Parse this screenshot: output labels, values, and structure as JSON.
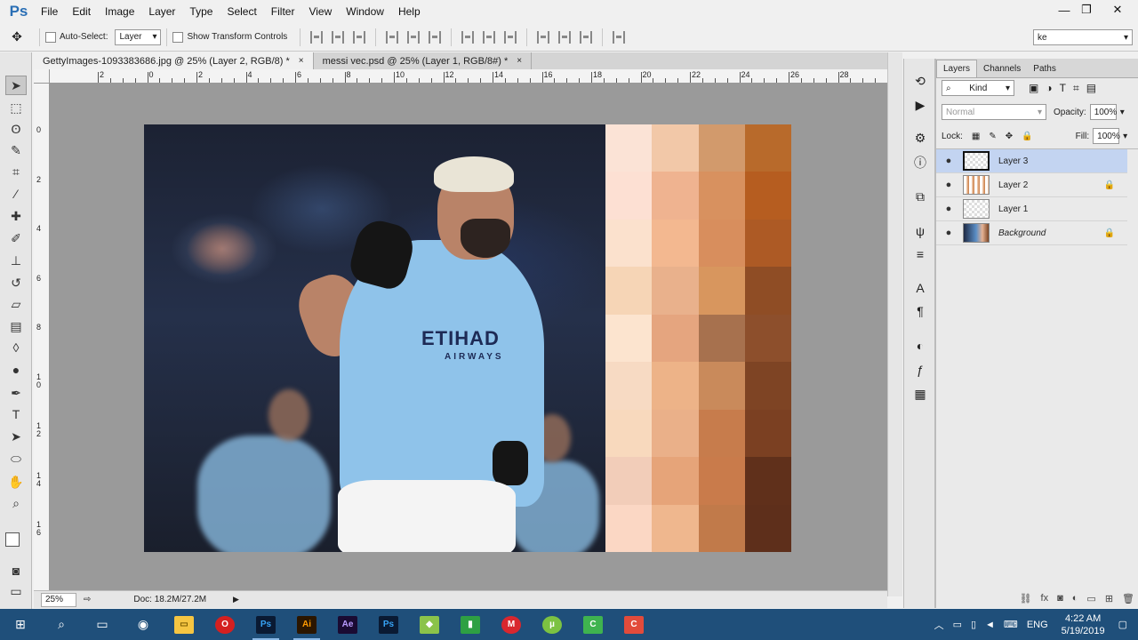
{
  "app": {
    "logo": "Ps"
  },
  "menu": [
    "File",
    "Edit",
    "Image",
    "Layer",
    "Type",
    "Select",
    "Filter",
    "View",
    "Window",
    "Help"
  ],
  "window_controls": {
    "minimize": "—",
    "restore": "❐",
    "close": "✕"
  },
  "options": {
    "auto_select_label": "Auto-Select:",
    "auto_select_value": "Layer",
    "transform_label": "Show Transform Controls",
    "workspace_value": "ke"
  },
  "tabs": [
    {
      "label": "GettyImages-1093383686.jpg @ 25% (Layer 2, RGB/8) *",
      "close": "×"
    },
    {
      "label": "messi vec.psd @ 25% (Layer 1, RGB/8#) *",
      "close": "×"
    }
  ],
  "ruler_top": [
    "2",
    "0",
    "2",
    "4",
    "6",
    "8",
    "10",
    "12",
    "14",
    "16",
    "18",
    "20",
    "22",
    "24",
    "26",
    "28"
  ],
  "ruler_left": [
    "0",
    "2",
    "4",
    "6",
    "8",
    "1\n0",
    "1\n2",
    "1\n4",
    "1\n6"
  ],
  "image": {
    "sponsor": "ETIHAD",
    "sponsor_sub": "AIRWAYS"
  },
  "swatch_colors": [
    "#fbe3d6",
    "#f2c8a8",
    "#d29a6c",
    "#b86a2b",
    "#fde0d3",
    "#efb390",
    "#d8915f",
    "#b65d20",
    "#fbe1cd",
    "#f3b890",
    "#d88e5d",
    "#ad5a25",
    "#f6d5b6",
    "#e9b18c",
    "#d8965e",
    "#8f4d25",
    "#fce4cf",
    "#e5a57f",
    "#a7714e",
    "#8d4f2c",
    "#f7dac3",
    "#edb388",
    "#c98a5b",
    "#7e4424",
    "#f8d9bd",
    "#eab089",
    "#c77c4c",
    "#7b4022",
    "#f2cdb9",
    "#e6a479",
    "#c97b4b",
    "#60301b",
    "#fbd7c4",
    "#efb78e",
    "#c17a4a",
    "#5e2f1b"
  ],
  "status": {
    "zoom": "25%",
    "doc": "Doc: 18.2M/27.2M"
  },
  "panel": {
    "tabs": [
      "Layers",
      "Channels",
      "Paths"
    ],
    "kind_label": "Kind",
    "blend_mode": "Normal",
    "opacity_label": "Opacity:",
    "opacity_value": "100%",
    "lock_label": "Lock:",
    "fill_label": "Fill:",
    "fill_value": "100%",
    "layers": [
      {
        "name": "Layer 3"
      },
      {
        "name": "Layer 2"
      },
      {
        "name": "Layer 1"
      },
      {
        "name": "Background"
      }
    ]
  },
  "tray": {
    "language": "ENG",
    "time": "4:22 AM",
    "date": "5/19/2019"
  },
  "taskbar_apps": [
    "Ps",
    "Ai",
    "Ae",
    "Ps"
  ]
}
